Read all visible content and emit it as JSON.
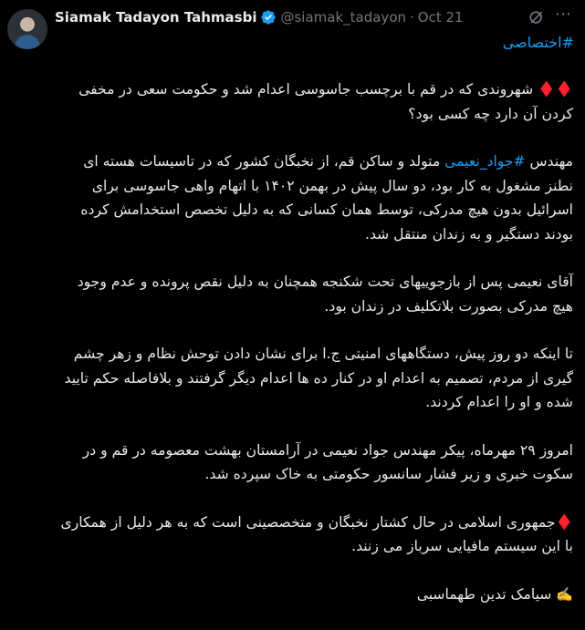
{
  "tweet": {
    "author_name": "Siamak Tadayon Tahmasbi",
    "handle": "@siamak_tadayon",
    "date": "Oct 21",
    "hashtag_top": "#اختصاصی",
    "diamonds_p1": "♦️♦️",
    "p1": " شهروندی که در قم با برچسب جاسوسی اعدام شد و حکومت سعی در مخفی کردن آن دارد چه کسی بود؟",
    "p2_prefix": "مهندس ",
    "p2_hashtag": "#جواد_نعیمی",
    "p2_rest": " متولد و ساکن قم، از نخبگان کشور که در تاسیسات هسته ای نطنز مشغول به کار بود، دو سال پیش در بهمن ۱۴۰۲ با اتهام واهی جاسوسی برای اسرائیل بدون هیچ مدرکی، توسط همان کسانی که به دلیل تخصص استخدامش کرده بودند دستگیر و به زندان منتقل شد.",
    "p3": "آقای نعیمی پس از بازجوییهای تحت شکنجه  همچنان به دلیل نقص پرونده و عدم وجود هیچ مدرکی بصورت بلاتکلیف در زندان بود.",
    "p4": " تا اینکه دو روز پیش، دستگاههای امنیتی ج.ا برای نشان دادن توحش نظام و زهر چشم گیری از مردم، تصمیم به اعدام او در کنار ده ها اعدام دیگر گرفتند و بلافاصله حکم تایید شده و او را اعدام کردند.",
    "p5": "امروز ۲۹ مهرماه، پیکر مهندس جواد نعیمی در آرامستان بهشت معصومه در قم و در سکوت خبری و زیر فشار سانسور حکومتی به خاک سپرده شد.",
    "diamond_p6": "♦️",
    "p6": "جمهوری اسلامی در حال کشتار نخبگان و متخصصینی است که به هر دلیل از همکاری با  این سیستم مافیایی سرباز می زنند.",
    "sig_icon": "✍️",
    "signature": " سیامک تدین طهماسبی"
  },
  "icons": {
    "verified": "verified-badge-icon",
    "grok": "grok-icon",
    "more": "more-options-icon"
  },
  "colors": {
    "background": "#000000",
    "text": "#e7e9ea",
    "secondary": "#71767b",
    "link": "#1d9bf0",
    "diamond": "#e0245e"
  }
}
